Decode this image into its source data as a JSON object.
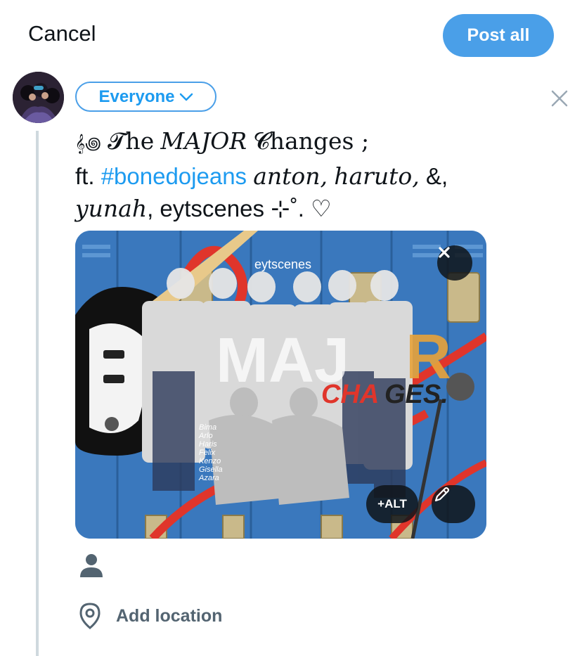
{
  "header": {
    "cancel_label": "Cancel",
    "post_all_label": "Post all"
  },
  "composer": {
    "audience_label": "Everyone",
    "text": {
      "line1_prefix": "𝄞꩜",
      "line1_the": "𝓣he",
      "line1_major": "MAJOR",
      "line1_changes": "𝓒hanges ;",
      "line2_ft": "ft.",
      "line2_hashtag": "#bonedojeans",
      "line2_anton": "anton,",
      "line2_haruto": "haruto,",
      "line2_amp": "&,",
      "line3_yunah": "yunah",
      "line3_rest": ", eytscenes ⊹˚. ♡"
    }
  },
  "media": {
    "watermark": "eytscenes",
    "names": [
      "Bima",
      "Arlo",
      "Haris",
      "Felix",
      "Kenzo",
      "Gisella",
      "Azara"
    ],
    "alt_label": "+ALT",
    "icons": {
      "remove": "close-icon",
      "edit": "pencil-icon"
    }
  },
  "actions": {
    "tag_people_icon": "person-icon",
    "location_icon": "location-pin-icon",
    "location_label": "Add location"
  },
  "colors": {
    "accent": "#1d9bf0",
    "button_bg": "#4a9fe8",
    "muted": "#536471",
    "thread_line": "#cfd9de"
  }
}
